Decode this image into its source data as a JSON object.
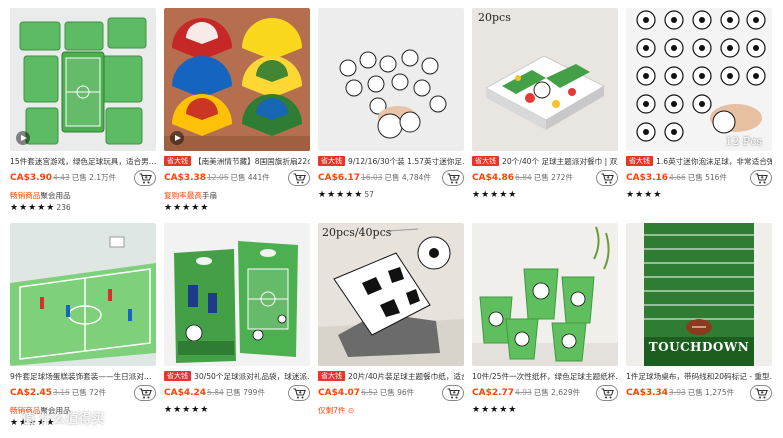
{
  "cart_icon": "shopping-cart-icon",
  "accent_price_color": "#ff4400",
  "badge_color": "#e8352b",
  "products": [
    {
      "title": "15件套迷宫游戏，绿色足球玩具，适合男…",
      "badge": "",
      "price": "CA$3.90",
      "old_price": "4.43",
      "sold": "已售 2.1万件",
      "sub_plain": "",
      "sub_highlight": "畅销商品",
      "sub_suffix": "聚会用品",
      "stars": "★★★★★",
      "rating_count": "236",
      "overlay": "",
      "has_play": true
    },
    {
      "title": "【南美洲情节藏】8国国旗折扇22c…",
      "badge": "省大钱",
      "price": "CA$3.38",
      "old_price": "12.05",
      "sold": "已售 441件",
      "sub_plain": "",
      "sub_highlight": "复购率最高",
      "sub_suffix": "手扇",
      "stars": "★★★★★",
      "rating_count": "",
      "overlay": "",
      "has_play": true
    },
    {
      "title": "9/12/16/30个装 1.57英寸迷你足…",
      "badge": "省大钱",
      "price": "CA$6.17",
      "old_price": "16.03",
      "sold": "已售 4,784件",
      "sub_plain": "",
      "sub_highlight": "",
      "sub_suffix": "",
      "stars": "★★★★★",
      "rating_count": "57",
      "overlay": "",
      "has_play": false
    },
    {
      "title": "20个/40个 足球主题派对餐巾 | 双…",
      "badge": "省大钱",
      "price": "CA$4.86",
      "old_price": "6.84",
      "sold": "已售 272件",
      "sub_plain": "",
      "sub_highlight": "",
      "sub_suffix": "",
      "stars": "★★★★★",
      "rating_count": "",
      "overlay": "20pcs",
      "has_play": false
    },
    {
      "title": "1.6英寸迷你泡沫足球，非常适合弹…",
      "badge": "省大钱",
      "price": "CA$3.16",
      "old_price": "4.66",
      "sold": "已售 516件",
      "sub_plain": "",
      "sub_highlight": "",
      "sub_suffix": "",
      "stars": "★★★★",
      "rating_count": "",
      "overlay": "12 Pcs",
      "has_play": false
    },
    {
      "title": "9件套足球场蛋糕装饰套装——生日派对…",
      "badge": "",
      "price": "CA$2.45",
      "old_price": "3.15",
      "sold": "已售 72件",
      "sub_plain": "",
      "sub_highlight": "畅销商品",
      "sub_suffix": "聚会用品",
      "stars": "★★★★★",
      "rating_count": "",
      "overlay": "",
      "has_play": false
    },
    {
      "title": "30/50个足球派对礼品袋，球迷派…",
      "badge": "省大钱",
      "price": "CA$4.24",
      "old_price": "5.84",
      "sold": "已售 799件",
      "sub_plain": "",
      "sub_highlight": "",
      "sub_suffix": "",
      "stars": "★★★★★",
      "rating_count": "",
      "overlay": "",
      "has_play": false
    },
    {
      "title": "20片/40片装足球主题餐巾纸，适合…",
      "badge": "省大钱",
      "price": "CA$4.07",
      "old_price": "6.52",
      "sold": "已售 96件",
      "sub_plain": "仅剩7件 ⊙",
      "sub_highlight": "",
      "sub_suffix": "",
      "stars": "",
      "rating_count": "",
      "overlay": "20pcs/40pcs",
      "has_play": false
    },
    {
      "title": "10件/25件一次性纸杯，绿色足球主题纸杯…",
      "badge": "",
      "price": "CA$2.77",
      "old_price": "4.93",
      "sold": "已售 2,629件",
      "sub_plain": "",
      "sub_highlight": "",
      "sub_suffix": "",
      "stars": "★★★★★",
      "rating_count": "",
      "overlay": "",
      "has_play": false
    },
    {
      "title": "1件足球场桌布，带码线和20码标记 - 重型…",
      "badge": "",
      "price": "CA$3.34",
      "old_price": "3.93",
      "sold": "已售 1,275件",
      "sub_plain": "",
      "sub_highlight": "",
      "sub_suffix": "",
      "stars": "",
      "rating_count": "",
      "overlay": "TOUCHDOWN",
      "has_play": false
    }
  ],
  "watermark": "值 什么值得买"
}
